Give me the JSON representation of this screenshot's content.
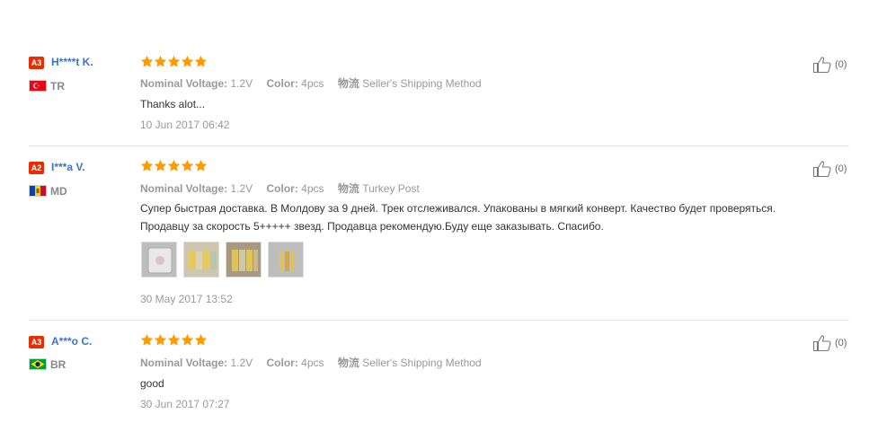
{
  "reviews": [
    {
      "level": "A3",
      "name": "H****t K.",
      "country": "TR",
      "flag_colors": [
        "#e30a17",
        "#ffffff"
      ],
      "rating_stars": 5,
      "meta": {
        "voltage_label": "Nominal Voltage:",
        "voltage_value": "1.2V",
        "color_label": "Color:",
        "color_value": "4pcs",
        "shipping_label": "物流",
        "shipping_value": "Seller's Shipping Method"
      },
      "text_lines": [
        "Thanks alot..."
      ],
      "date": "10 Jun 2017 06:42",
      "likes": "(0)"
    },
    {
      "level": "A2",
      "name": "I***a V.",
      "country": "MD",
      "flag_colors": [
        "#0046ae",
        "#ffd200",
        "#cc092f"
      ],
      "rating_stars": 5,
      "meta": {
        "voltage_label": "Nominal Voltage:",
        "voltage_value": "1.2V",
        "color_label": "Color:",
        "color_value": "4pcs",
        "shipping_label": "物流",
        "shipping_value": "Turkey Post"
      },
      "text_lines": [
        "Супер быстрая доставка. В Молдову за 9 дней. Трек отслеживался. Упакованы в мягкий конверт. Качество будет проверяться.",
        "Продавцу за скорость 5+++++ звезд. Продавца рекомендую.Буду еще заказывать. Спасибо."
      ],
      "photos": [
        "photo-1",
        "photo-2",
        "photo-3",
        "photo-4"
      ],
      "date": "30 May 2017 13:52",
      "likes": "(0)"
    },
    {
      "level": "A3",
      "name": "A***o C.",
      "country": "BR",
      "flag_colors": [
        "#009b3a",
        "#fedf00",
        "#002776"
      ],
      "rating_stars": 5,
      "meta": {
        "voltage_label": "Nominal Voltage:",
        "voltage_value": "1.2V",
        "color_label": "Color:",
        "color_value": "4pcs",
        "shipping_label": "物流",
        "shipping_value": "Seller's Shipping Method"
      },
      "text_lines": [
        "good"
      ],
      "date": "30 Jun 2017 07:27",
      "likes": "(0)"
    }
  ],
  "colors": {
    "badge": "#e62e04",
    "name": "#3a74c9",
    "star": "#ff9a00",
    "divider": "#e6e6e6"
  }
}
